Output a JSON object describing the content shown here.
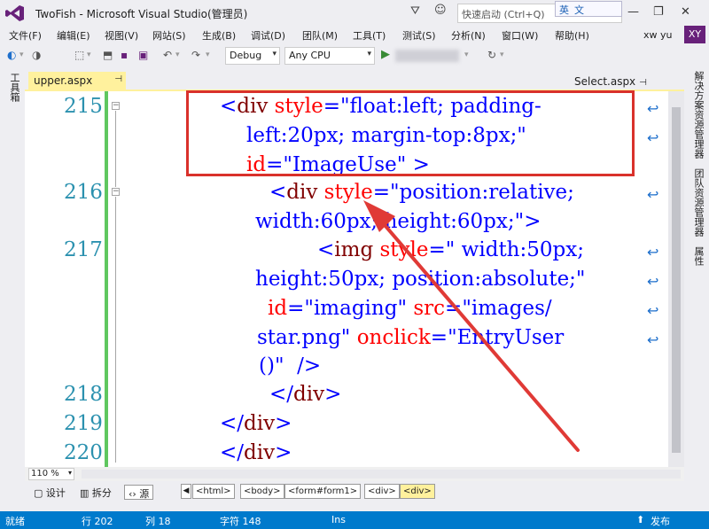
{
  "titlebar": {
    "title": "TwoFish - Microsoft Visual Studio(管理员)",
    "quick_launch_placeholder": "快速启动 (Ctrl+Q)",
    "ime_label": "英",
    "ime_label2": "文",
    "minimize": "—",
    "restore": "❐",
    "close": "✕",
    "notif_icon": "⛛",
    "feedback_icon": "☺"
  },
  "menu": {
    "items": [
      "文件(F)",
      "编辑(E)",
      "视图(V)",
      "网站(S)",
      "生成(B)",
      "调试(D)",
      "团队(M)",
      "工具(T)",
      "测试(S)",
      "分析(N)",
      "窗口(W)",
      "帮助(H)"
    ],
    "user_name": "xw yu",
    "user_initials": "XY"
  },
  "toolbar": {
    "config": "Debug",
    "platform": "Any CPU",
    "combo_arrow": "▾",
    "icons": {
      "back": "◐",
      "forward": "◑",
      "new": "⬚",
      "open": "⬒",
      "save": "▪",
      "save_all": "▣",
      "undo": "↶",
      "redo": "↷",
      "run": "▶",
      "refresh": "↻",
      "dd": "▾"
    }
  },
  "left_tool_window": "工具箱",
  "right_tool_windows": [
    "解决方案资源管理器",
    "团队资源管理器",
    "属性"
  ],
  "tabs": {
    "active": "upper.aspx",
    "other": "Select.aspx",
    "pin": "⊣"
  },
  "editor": {
    "lines": [
      {
        "number": "215"
      },
      {
        "number": "216"
      },
      {
        "number": "217"
      },
      {
        "number": "218"
      },
      {
        "number": "219"
      },
      {
        "number": "220"
      }
    ],
    "code": {
      "l215_a": [
        "<",
        "div",
        " style",
        "=",
        "\"float:left; padding-"
      ],
      "l215_b": [
        "left:20px; margin-top:8px;\""
      ],
      "l215_c": [
        "id",
        "=",
        "\"ImageUse\"",
        " >"
      ],
      "l216_a": [
        "<",
        "div",
        " style",
        "=",
        "\"position:relative;"
      ],
      "l216_b": [
        "width:60px; height:60px;\"",
        ">"
      ],
      "l217_a": [
        "<",
        "img",
        " style",
        "=",
        "\" width:50px;"
      ],
      "l217_b": [
        "height:50px; position:absolute;\""
      ],
      "l217_c": [
        "id",
        "=",
        "\"imaging\"",
        " src",
        "=",
        "\"images/"
      ],
      "l217_d": [
        "star.png\"",
        " onclick",
        "=",
        "\"EntryUser"
      ],
      "l217_e": [
        "()\"",
        "  />"
      ],
      "l218": [
        "</",
        "div",
        ">"
      ],
      "l219": [
        "</",
        "div",
        ">"
      ],
      "l220": [
        "</",
        "div",
        ">"
      ]
    },
    "wrap_glyph": "↩",
    "fold_minus": "−"
  },
  "lower": {
    "zoom": "110 %",
    "view_design": "设计",
    "view_split": "拆分",
    "view_source": "源",
    "breadcrumbs": [
      "<html>",
      "<body>",
      "<form#form1>",
      "<div>",
      "<div>"
    ],
    "prev": "◀"
  },
  "status": {
    "ready": "就绪",
    "row": "行 202",
    "col": "列 18",
    "char": "字符 148",
    "mode": "Ins",
    "publish": "发布",
    "publish_icon": "⬆"
  },
  "colors": {
    "accent": "#007acc",
    "highlight_box": "#d9312b",
    "tab_active": "#fff19d",
    "change_bar": "#5fc75f"
  }
}
